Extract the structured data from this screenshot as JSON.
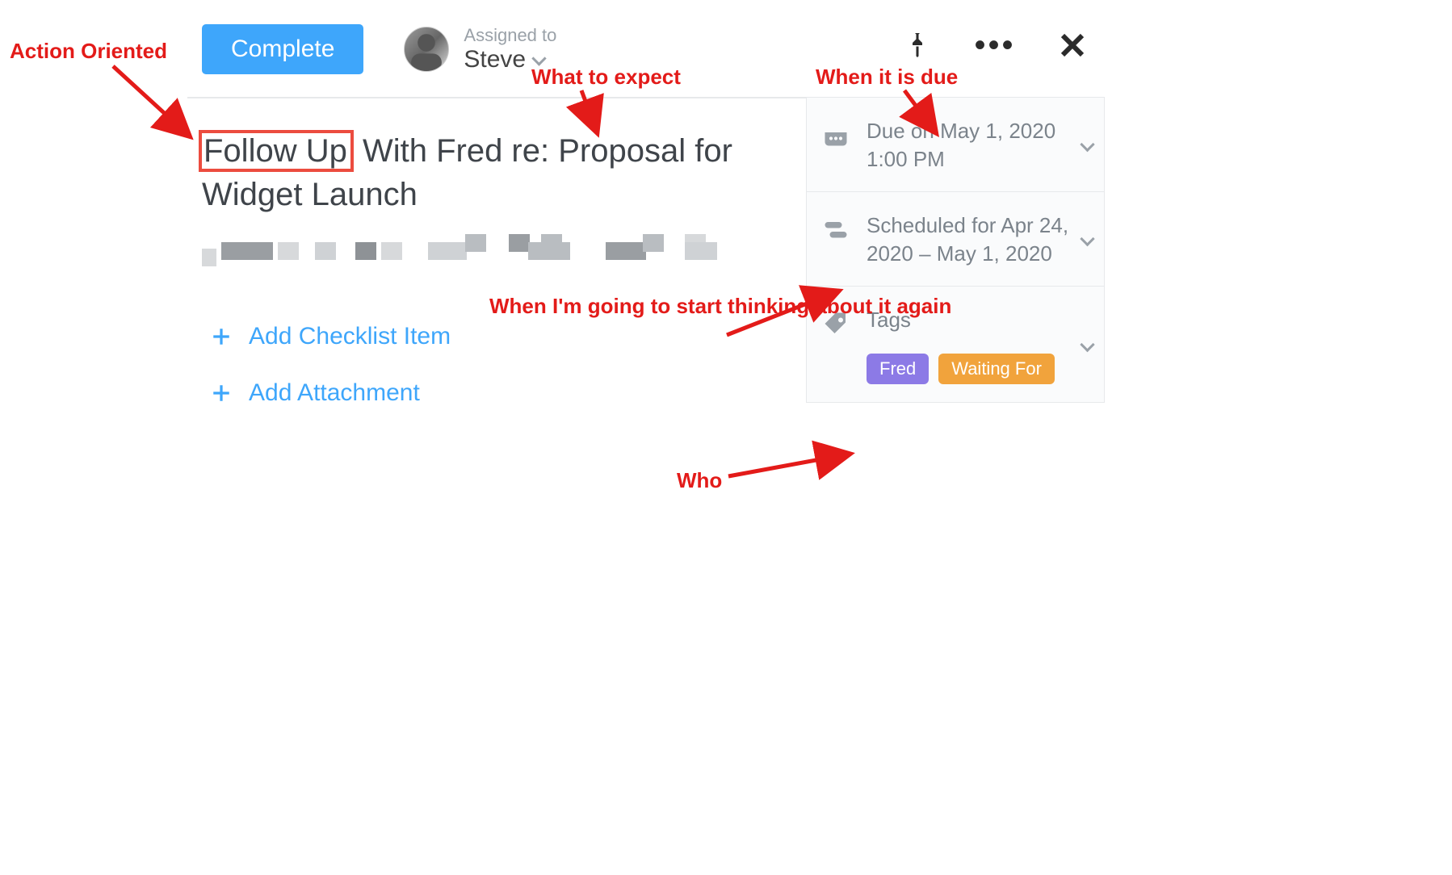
{
  "topbar": {
    "complete_label": "Complete",
    "assigned_label": "Assigned to",
    "assignee_name": "Steve"
  },
  "task": {
    "title_highlight": "Follow Up",
    "title_rest": " With Fred re: Proposal for Widget Launch"
  },
  "actions": {
    "add_checklist": "Add Checklist Item",
    "add_attachment": "Add Attachment"
  },
  "sidebar": {
    "due_text": "Due on May 1, 2020 1:00 PM",
    "schedule_text": "Scheduled for Apr 24, 2020 – May 1, 2020",
    "tags_label": "Tags",
    "tags": [
      {
        "label": "Fred",
        "color": "purple"
      },
      {
        "label": "Waiting For",
        "color": "orange"
      }
    ]
  },
  "annotations": {
    "action_oriented": "Action Oriented",
    "what_to_expect": "What to expect",
    "when_due": "When it is due",
    "when_start": "When I'm going to start thinking about it again",
    "who": "Who"
  }
}
